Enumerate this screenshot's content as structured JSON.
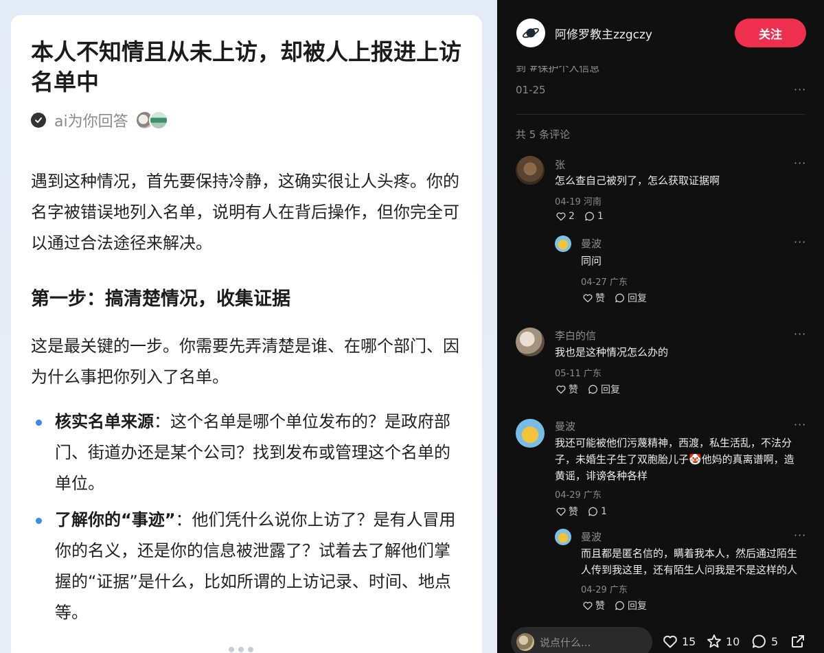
{
  "article": {
    "title": "本人不知情且从未上访，却被人上报进上访名单中",
    "author": "ai为你回答",
    "intro": "遇到这种情况，首先要保持冷静，这确实很让人头疼。你的名字被错误地列入名单，说明有人在背后操作，但你完全可以通过合法途径来解决。",
    "step1_heading": "第一步：搞清楚情况，收集证据",
    "step1_body": "这是最关键的一步。你需要先弄清楚是谁、在哪个部门、因为什么事把你列入了名单。",
    "bullets": [
      {
        "label": "核实名单来源",
        "sep": "：",
        "text": "这个名单是哪个单位发布的？是政府部门、街道办还是某个公司？找到发布或管理这个名单的单位。"
      },
      {
        "label": "了解你的“事迹”",
        "sep": "：",
        "text": "他们凭什么说你上访了？是有人冒用你的名义，还是你的信息被泄露了？试着去了解他们掌握的“证据”是什么，比如所谓的上访记录、时间、地点等。"
      }
    ]
  },
  "post": {
    "account_name": "阿修罗教主zzgczy",
    "follow_label": "关注",
    "truncated_line": "到 #保护个人信息",
    "date": "01-25",
    "comment_count_label": "共 5 条评论",
    "more_label": "···"
  },
  "comments": [
    {
      "name": "张",
      "text": "怎么查自己被列了，怎么获取证据啊",
      "date": "04-19",
      "loc": "河南",
      "likes": "2",
      "replies": "1",
      "like_label": "",
      "reply_label": ""
    },
    {
      "name": "曼波",
      "text": "同问",
      "date": "04-27",
      "loc": "广东",
      "like_label": "赞",
      "reply_label": "回复"
    },
    {
      "name": "李白的信",
      "text": "我也是这种情况怎么办的",
      "date": "05-11",
      "loc": "广东",
      "like_label": "赞",
      "reply_label": "回复"
    },
    {
      "name": "曼波",
      "text": "我还可能被他们污蔑精神，西渡，私生活乱，不法分子，未婚生子生了双胞胎儿子🤡他妈的真离谱啊，造黄谣，诽谤各种各样",
      "date": "04-29",
      "loc": "广东",
      "like_label": "赞",
      "replies": "1"
    },
    {
      "name": "曼波",
      "text": "而且都是匿名信的，瞒着我本人，然后通过陌生人传到我这里，还有陌生人问我是不是这样的人",
      "date": "04-29",
      "loc": "广东",
      "like_label": "赞",
      "reply_label": "回复"
    }
  ],
  "bottom": {
    "input_placeholder": "说点什么...",
    "likes": "15",
    "stars": "10",
    "comments": "5"
  },
  "colors": {
    "accent_red": "#ef2f4e",
    "bullet_blue": "#3b8beb",
    "dark_bg": "#101010"
  },
  "icons": [
    "check-icon",
    "planet-icon",
    "heart-icon",
    "comment-bubble-icon",
    "star-icon",
    "share-icon",
    "more-dots-icon"
  ]
}
